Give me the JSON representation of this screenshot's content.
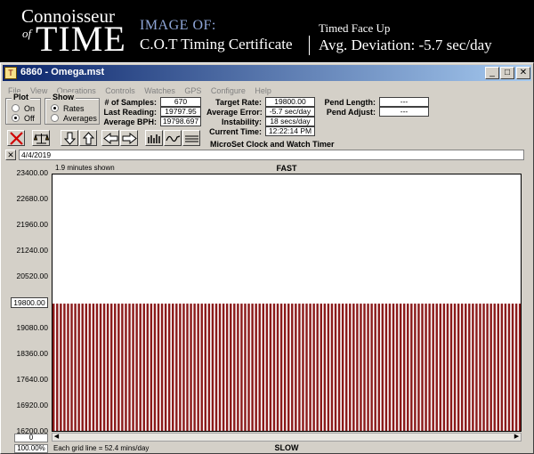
{
  "banner": {
    "brand_line1": "Connoisseur",
    "brand_of": "of",
    "brand_line2": "TIME",
    "image_of": "IMAGE OF:",
    "certificate": "C.O.T Timing Certificate",
    "position": "Timed Face Up",
    "avg_deviation": "Avg. Deviation: -5.7 sec/day"
  },
  "window": {
    "title": "6860 - Omega.mst",
    "icon_text": "T",
    "buttons": {
      "minimize": "_",
      "maximize": "□",
      "close": "✕"
    }
  },
  "menu": [
    "File",
    "View",
    "Operations",
    "Controls",
    "Watches",
    "GPS",
    "Configure",
    "Help"
  ],
  "plot_group": {
    "title": "Plot",
    "options": [
      "On",
      "Off"
    ],
    "selected": "Off"
  },
  "show_group": {
    "title": "Show",
    "options": [
      "Rates",
      "Averages"
    ],
    "selected": "Rates"
  },
  "stats": {
    "samples_label": "# of Samples:",
    "samples": "670",
    "last_label": "Last Reading:",
    "last": "19797.95",
    "avg_bph_label": "Average BPH:",
    "avg_bph": "19798.697",
    "target_label": "Target Rate:",
    "target": "19800.00",
    "avg_err_label": "Average Error:",
    "avg_err": "-5.7 sec/day",
    "instab_label": "Instability:",
    "instab": "18 secs/day",
    "time_label": "Current Time:",
    "time": "12:22:14 PM",
    "pend_len_label": "Pend Length:",
    "pend_len": "---",
    "pend_adj_label": "Pend Adjust:",
    "pend_adj": "---"
  },
  "app_title": "MicroSet Clock and Watch Timer",
  "toolbar_icons": [
    "delete-icon",
    "balance-icon",
    "arrow-down-icon",
    "arrow-up-icon",
    "arrow-left-icon",
    "arrow-right-icon",
    "bar-chart-icon",
    "wave-icon",
    "lines-icon"
  ],
  "date_close": "✕",
  "date": "4/4/2019",
  "chart_data": {
    "type": "bar",
    "title": "FAST",
    "bottom_label": "SLOW",
    "minutes_shown": "1.9 minutes shown",
    "gridline_note": "Each grid line = 52.4 mins/day",
    "zoom": "100.00%",
    "offset": "0",
    "y_ticks": [
      "23400.00",
      "22680.00",
      "21960.00",
      "21240.00",
      "20520.00",
      "19800.00",
      "19080.00",
      "18360.00",
      "17640.00",
      "16920.00",
      "16200.00"
    ],
    "highlight_tick": "19800.00",
    "ylim": [
      16200,
      23400
    ],
    "baseline": 16200,
    "bar_value": 19798,
    "bar_count": 130,
    "bar_color": "#8b1a1a",
    "scroll_left": "◀",
    "scroll_right": "▶"
  }
}
